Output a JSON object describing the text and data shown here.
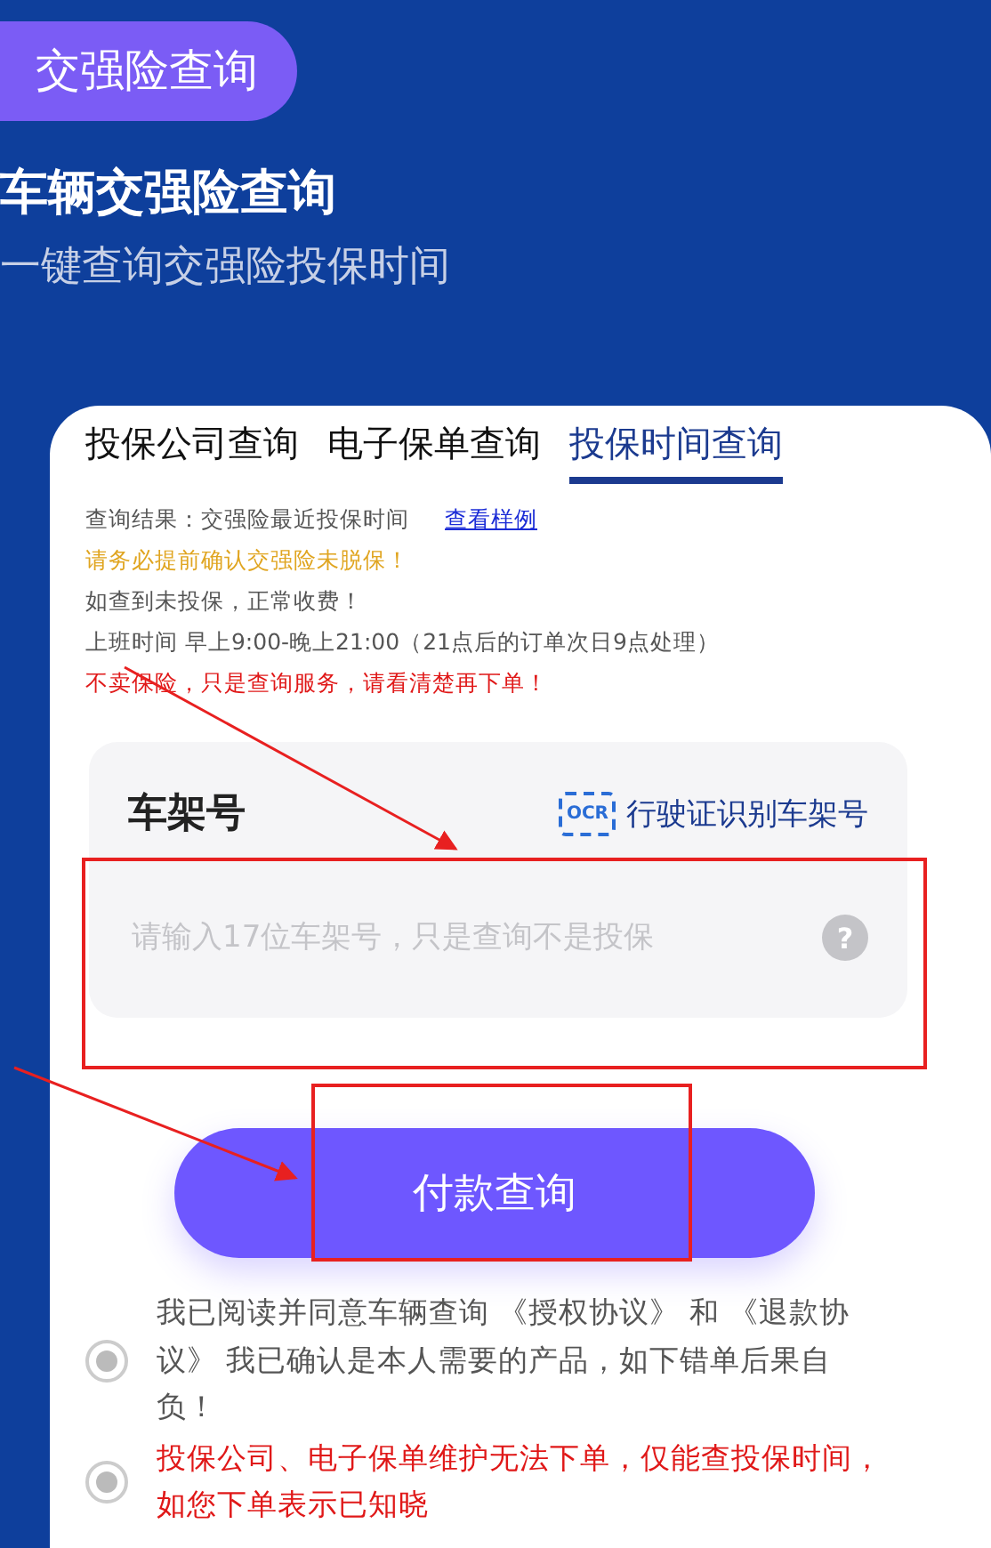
{
  "badge": "交强险查询",
  "header": {
    "title": "车辆交强险查询",
    "subtitle": "一键查询交强险投保时间"
  },
  "tabs": [
    {
      "label": "投保公司查询",
      "selected": false
    },
    {
      "label": "电子保单查询",
      "selected": false
    },
    {
      "label": "投保时间查询",
      "selected": true
    }
  ],
  "info": {
    "result_label": "查询结果：交强险最近投保时间",
    "sample_link": "查看样例",
    "notes": [
      {
        "text": "请务必提前确认交强险未脱保！",
        "kind": "warning"
      },
      {
        "text": "如查到未投保，正常收费！",
        "kind": "normal"
      },
      {
        "text": "上班时间 早上9:00-晚上21:00（21点后的订单次日9点处理）",
        "kind": "normal"
      },
      {
        "text": "不卖保险，只是查询服务，请看清楚再下单！",
        "kind": "alert"
      }
    ]
  },
  "form": {
    "label": "车架号",
    "ocr_badge": "OCR",
    "ocr_link": "行驶证识别车架号",
    "placeholder": "请输入17位车架号，只是查询不是投保",
    "help": "?"
  },
  "submit": "付款查询",
  "agreements": [
    {
      "text": "我已阅读并同意车辆查询 《授权协议》 和 《退款协议》 我已确认是本人需要的产品，如下错单后果自负！",
      "kind": "normal",
      "selected": true
    },
    {
      "text": "投保公司、电子保单维护无法下单，仅能查投保时间，如您下单表示已知晓",
      "kind": "alert",
      "selected": true
    }
  ]
}
